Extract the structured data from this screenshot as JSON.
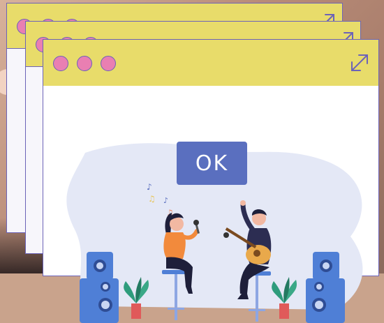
{
  "dialog": {
    "button_label": "OK"
  },
  "colors": {
    "titlebar": "#e8dc6a",
    "window_border": "#6c63b8",
    "traffic_dot": "#e97fb2",
    "button": "#5a6fbf",
    "blob": "#e4e8f6"
  },
  "icons": {
    "window_controls": [
      "dot",
      "dot",
      "dot"
    ],
    "maximize": "expand-arrow-icon"
  },
  "illustration": {
    "subject": "karaoke-duo-illustration"
  }
}
